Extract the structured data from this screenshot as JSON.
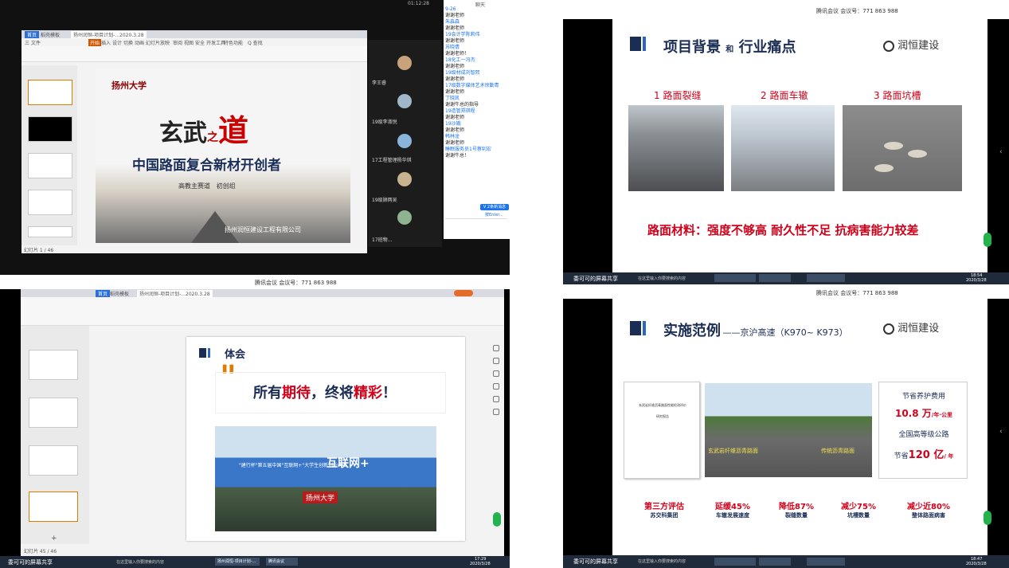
{
  "q1": {
    "window_timer": "01:12:28",
    "chat_header": "聊天",
    "tabs": [
      "首页",
      "稻壳模板",
      "扬州润恒-项目计划-...2020.3.28"
    ],
    "menu": [
      "三 文件",
      "开始",
      "插入",
      "设计",
      "切换",
      "动画",
      "幻灯片放映",
      "审阅",
      "视图",
      "安全",
      "开发工具",
      "特色功能",
      "Q 查找"
    ],
    "slide": {
      "university": "扬州大学",
      "title_a": "玄武",
      "title_b": "之",
      "title_c": "道",
      "subtitle": "中国路面复合新材开创者",
      "track": "高教主赛道",
      "group": "初创组",
      "company": "扬州润恒建设工程有限公司"
    },
    "status": "幻灯片 1 / 46",
    "participants": [
      "李王睿",
      "19级李淑悦",
      "17工程管理杨华琪",
      "19级顾两吴",
      "17班物..."
    ],
    "chat": [
      {
        "name": "",
        "msg": "9-26"
      },
      {
        "name": "",
        "msg": "谢谢老师"
      },
      {
        "name": "朱淼森",
        "msg": "谢谢老师"
      },
      {
        "name": "19会计学陈莉伟",
        "msg": "谢谢老师"
      },
      {
        "name": "苏晓倩",
        "msg": "谢谢老师！"
      },
      {
        "name": "18化工一冯杰",
        "msg": "谢谢老师"
      },
      {
        "name": "19级材成刘智熙",
        "msg": "谢谢老师"
      },
      {
        "name": "17级数字媒体艺术徐勤青",
        "msg": "谢谢老师"
      },
      {
        "name": "丁晓凯",
        "msg": "谢谢牛总的指导"
      },
      {
        "name": "19造管郑琪程",
        "msg": "谢谢老师"
      },
      {
        "name": "19沙娥",
        "msg": "谢谢老师"
      },
      {
        "name": "韩林淦",
        "msg": "谢谢老师"
      },
      {
        "name": "睡眠服务员1号蔡钊宏",
        "msg": "谢谢牛总！"
      }
    ],
    "chat_new_btn": "V 2条新消息",
    "chat_send": "按Enter..."
  },
  "q2": {
    "meeting": "腾讯会议 会议号：771 863 988",
    "title_a": "项目背景",
    "title_and": "和",
    "title_b": "行业痛点",
    "logo": "润恒建设",
    "caps": [
      "1 路面裂缝",
      "2 路面车辙",
      "3 路面坑槽"
    ],
    "conclusion": "路面材料：强度不够高 耐久性不足 抗病害能力较差",
    "clock": "18:54",
    "date": "2020/3/28",
    "share_label": "委可可的屏幕共享",
    "search": "在这里输入你要搜索的内容"
  },
  "q3": {
    "meeting": "腾讯会议 会议号：771 863 988",
    "tabs": [
      "首页",
      "稻壳模板",
      "扬州润恒-项目计划-...2020.3.28"
    ],
    "slide_title": "体会",
    "quote_a": "所有",
    "quote_b": "期待",
    "quote_c": "，终将",
    "quote_d": "精彩",
    "quote_e": "！",
    "banner_text": "\"建行杯\"第五届中国\"互联网+\"大学生创新创业大赛",
    "banner_brand": "互联网+",
    "flag": "扬州大学",
    "status": "幻灯片 45 / 46",
    "share_label": "委可可的屏幕共享",
    "search": "在这里输入你要搜索的内容",
    "taskbar": [
      "扬州润恒-项目计划-...",
      "腾讯会议"
    ],
    "clock": "17:29",
    "date": "2020/3/28"
  },
  "q4": {
    "meeting": "腾讯会议 会议号：771 863 988",
    "title": "实施范例",
    "subtitle": "——京沪高速（K970~ K973）",
    "logo": "润恒建设",
    "report_title": "玄武岩纤维沥青路面性能检测评价",
    "report_sub": "研究报告",
    "photo_left": "玄武岩纤维沥青路面",
    "photo_right": "传统沥青路面",
    "r1": "节省养护费用",
    "r2_num": "10.8 万",
    "r2_unit": "/年·公里",
    "r3": "全国高等级公路",
    "r4_a": "节省",
    "r4_num": "120 亿",
    "r4_unit": "/ 年",
    "stats": [
      {
        "top": "第三方评估",
        "bot": "苏交科集团"
      },
      {
        "top": "延缓45%",
        "bot": "车辙发展速度"
      },
      {
        "top": "降低87%",
        "bot": "裂缝数量"
      },
      {
        "top": "减少75%",
        "bot": "坑槽数量"
      },
      {
        "top": "减少近80%",
        "bot": "整体路面病害"
      }
    ],
    "share_label": "委可可的屏幕共享",
    "search": "在这里输入你要搜索的内容",
    "clock": "18:47",
    "date": "2020/3/28"
  }
}
